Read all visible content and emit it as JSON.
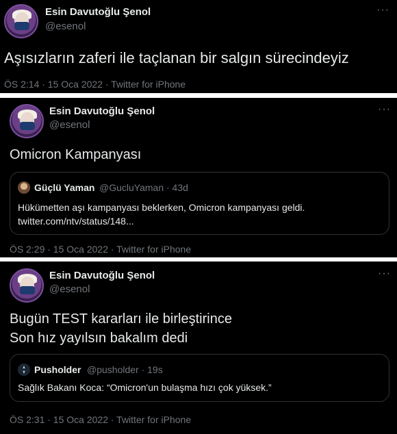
{
  "tweets": [
    {
      "author_name": "Esin Davutoğlu Şenol",
      "author_handle": "@esenol",
      "text_lines": [
        "Aşısızların zaferi ile taçlanan bir salgın sürecindeyiz"
      ],
      "meta": "ÖS 2:14 · 15 Oca 2022 · Twitter for iPhone"
    },
    {
      "author_name": "Esin Davutoğlu Şenol",
      "author_handle": "@esenol",
      "text_lines": [
        "Omicron Kampanyası"
      ],
      "quote": {
        "name": "Güçlü Yaman",
        "handle_time": "@GucluYaman · 43d",
        "text_lines": [
          "Hükümetten aşı kampanyası beklerken, Omicron kampanyası geldi.",
          "twitter.com/ntv/status/148..."
        ]
      },
      "meta": "ÖS 2:29 · 15 Oca 2022 · Twitter for iPhone"
    },
    {
      "author_name": "Esin Davutoğlu Şenol",
      "author_handle": "@esenol",
      "text_lines": [
        "Bugün TEST kararları ile birleştirince",
        "Son hız yayılsın bakalım dedi"
      ],
      "quote": {
        "name": "Pusholder",
        "handle_time": "@pusholder · 19s",
        "text_lines": [
          "Sağlık Bakanı Koca: “Omicron'un bulaşma hızı çok yüksek.”"
        ]
      },
      "meta": "ÖS 2:31 · 15 Oca 2022 · Twitter for iPhone"
    }
  ],
  "icons": {
    "more": "···",
    "more_icon_name": "more-options-icon"
  },
  "colors": {
    "background": "#000000",
    "text": "#e7e9ea",
    "secondary_text": "#71767b",
    "separator": "#ffffff",
    "quote_border": "#2f3336"
  }
}
